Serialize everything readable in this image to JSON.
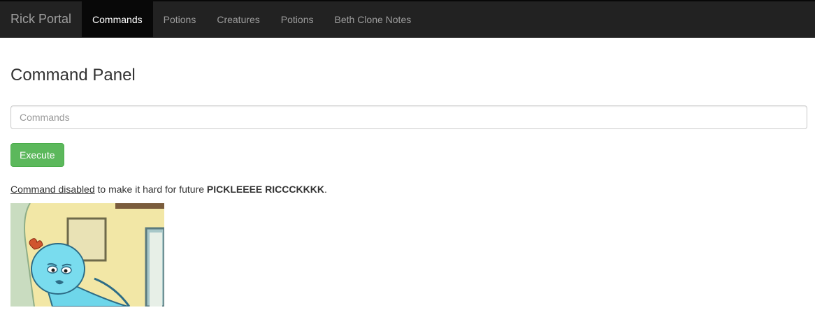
{
  "navbar": {
    "brand": "Rick Portal",
    "items": [
      {
        "label": "Commands",
        "active": true
      },
      {
        "label": "Potions",
        "active": false
      },
      {
        "label": "Creatures",
        "active": false
      },
      {
        "label": "Potions",
        "active": false
      },
      {
        "label": "Beth Clone Notes",
        "active": false
      }
    ]
  },
  "main": {
    "title": "Command Panel",
    "command_input": {
      "placeholder": "Commands",
      "value": ""
    },
    "execute_label": "Execute",
    "notice": {
      "underlined": "Command disabled",
      "middle": " to make it hard for future ",
      "bold": "PICKLEEEE RICCCKKKK",
      "end": "."
    },
    "image": {
      "subject": "meeseeks-cartoon"
    }
  },
  "colors": {
    "navbar_bg": "#222222",
    "active_tab_bg": "#080808",
    "button_green": "#5cb85c"
  }
}
